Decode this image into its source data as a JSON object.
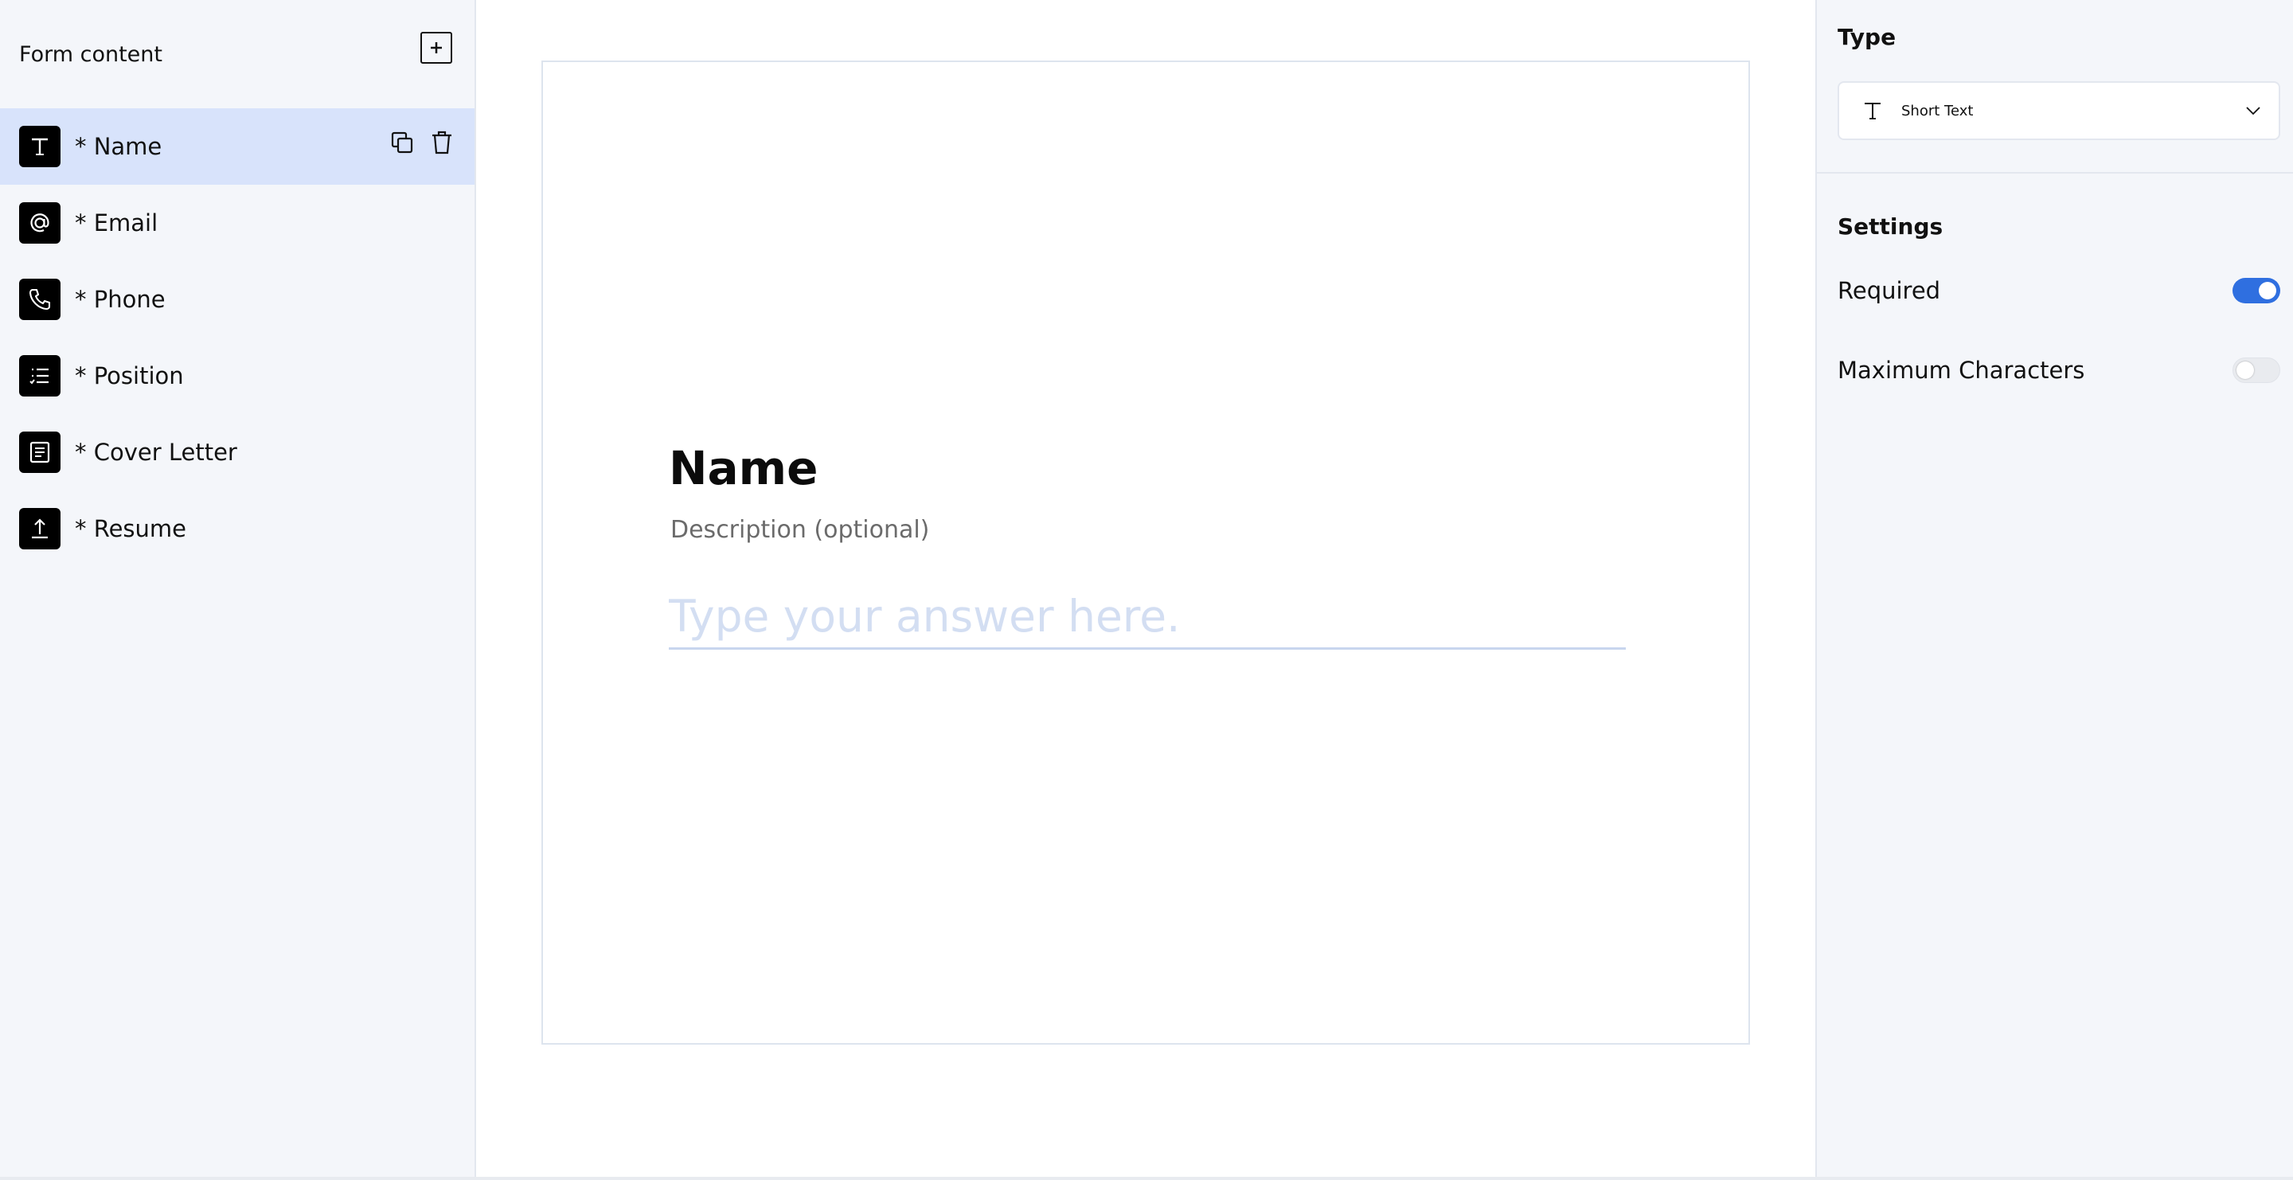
{
  "sidebar": {
    "title": "Form content",
    "add_icon": "plus-square-icon",
    "items": [
      {
        "label": "* Name",
        "icon": "text-t-icon",
        "active": true
      },
      {
        "label": "* Email",
        "icon": "at-sign-icon",
        "active": false
      },
      {
        "label": "* Phone",
        "icon": "phone-icon",
        "active": false
      },
      {
        "label": "* Position",
        "icon": "checklist-icon",
        "active": false
      },
      {
        "label": "* Cover Letter",
        "icon": "document-icon",
        "active": false
      },
      {
        "label": "* Resume",
        "icon": "upload-icon",
        "active": false
      }
    ],
    "item_actions": [
      "copy-icon",
      "trash-icon"
    ]
  },
  "canvas": {
    "question_title": "Name",
    "description": "Description (optional)",
    "answer_placeholder": "Type your answer here."
  },
  "panel": {
    "type_heading": "Type",
    "type_value": "Short Text",
    "settings_heading": "Settings",
    "settings": [
      {
        "label": "Required",
        "enabled": true
      },
      {
        "label": "Maximum Characters",
        "enabled": false
      }
    ]
  },
  "colors": {
    "accent": "#2f6fe0",
    "active_row": "#d8e3fb",
    "panel_bg": "#f4f6fa"
  }
}
